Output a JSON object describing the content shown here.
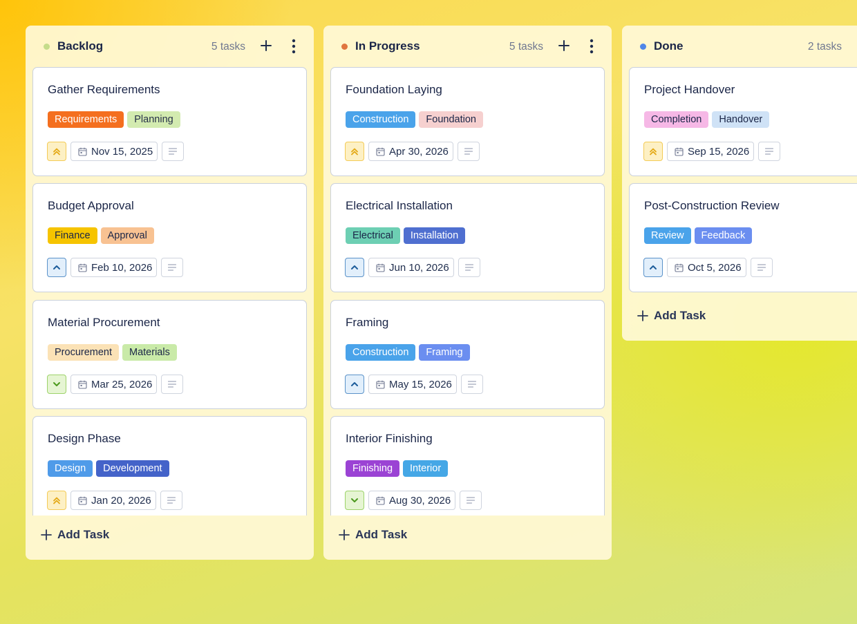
{
  "colors": {
    "dot_backlog": "#c5dc8a",
    "dot_in_progress": "#e0753f",
    "dot_done": "#4f86e8"
  },
  "columns": [
    {
      "title": "Backlog",
      "count": "5 tasks",
      "add_task_label": "Add Task",
      "cards": [
        {
          "title": "Gather Requirements",
          "tags": [
            {
              "label": "Requirements",
              "bg": "#f46f1f",
              "fg": "#ffffff"
            },
            {
              "label": "Planning",
              "bg": "#d3ebb0",
              "fg": "#263049"
            }
          ],
          "priority": "urgent",
          "priority_icon": "double-chevron-up-icon",
          "date": "Nov 15, 2025"
        },
        {
          "title": "Budget Approval",
          "tags": [
            {
              "label": "Finance",
              "bg": "#f6c400",
              "fg": "#1a2547"
            },
            {
              "label": "Approval",
              "bg": "#f8c292",
              "fg": "#1a2547"
            }
          ],
          "priority": "high",
          "priority_icon": "chevron-up-icon",
          "date": "Feb 10, 2026"
        },
        {
          "title": "Material Procurement",
          "tags": [
            {
              "label": "Procurement",
              "bg": "#fbe2b6",
              "fg": "#1a2547"
            },
            {
              "label": "Materials",
              "bg": "#c9eaa8",
              "fg": "#1a2547"
            }
          ],
          "priority": "low",
          "priority_icon": "chevron-down-icon",
          "date": "Mar 25, 2026"
        },
        {
          "title": "Design Phase",
          "tags": [
            {
              "label": "Design",
              "bg": "#4f9be9",
              "fg": "#ffffff"
            },
            {
              "label": "Development",
              "bg": "#4463c9",
              "fg": "#ffffff"
            }
          ],
          "priority": "urgent",
          "priority_icon": "double-chevron-up-icon",
          "date": "Jan 20, 2026"
        }
      ]
    },
    {
      "title": "In Progress",
      "count": "5 tasks",
      "add_task_label": "Add Task",
      "cards": [
        {
          "title": "Foundation Laying",
          "tags": [
            {
              "label": "Construction",
              "bg": "#4aa3ea",
              "fg": "#ffffff"
            },
            {
              "label": "Foundation",
              "bg": "#f6d0cf",
              "fg": "#1a2547"
            }
          ],
          "priority": "urgent",
          "priority_icon": "double-chevron-up-icon",
          "date": "Apr 30, 2026"
        },
        {
          "title": "Electrical Installation",
          "tags": [
            {
              "label": "Electrical",
              "bg": "#6dcfb3",
              "fg": "#1a2547"
            },
            {
              "label": "Installation",
              "bg": "#4f6fd0",
              "fg": "#ffffff"
            }
          ],
          "priority": "high",
          "priority_icon": "chevron-up-icon",
          "date": "Jun 10, 2026"
        },
        {
          "title": "Framing",
          "tags": [
            {
              "label": "Construction",
              "bg": "#4aa3ea",
              "fg": "#ffffff"
            },
            {
              "label": "Framing",
              "bg": "#6b8ef0",
              "fg": "#ffffff"
            }
          ],
          "priority": "high",
          "priority_icon": "chevron-up-icon",
          "date": "May 15, 2026"
        },
        {
          "title": "Interior Finishing",
          "tags": [
            {
              "label": "Finishing",
              "bg": "#9b43d4",
              "fg": "#ffffff"
            },
            {
              "label": "Interior",
              "bg": "#45a7e6",
              "fg": "#ffffff"
            }
          ],
          "priority": "low",
          "priority_icon": "chevron-down-icon",
          "date": "Aug 30, 2026"
        }
      ]
    },
    {
      "title": "Done",
      "count": "2 tasks",
      "add_task_label": "Add Task",
      "cards": [
        {
          "title": "Project Handover",
          "tags": [
            {
              "label": "Completion",
              "bg": "#f6b8e6",
              "fg": "#1a2547"
            },
            {
              "label": "Handover",
              "bg": "#cfe2f6",
              "fg": "#1a2547"
            }
          ],
          "priority": "urgent",
          "priority_icon": "double-chevron-up-icon",
          "date": "Sep 15, 2026"
        },
        {
          "title": "Post-Construction Review",
          "tags": [
            {
              "label": "Review",
              "bg": "#4aa3ea",
              "fg": "#ffffff"
            },
            {
              "label": "Feedback",
              "bg": "#6b8ef0",
              "fg": "#ffffff"
            }
          ],
          "priority": "high",
          "priority_icon": "chevron-up-icon",
          "date": "Oct 5, 2026"
        }
      ]
    }
  ]
}
